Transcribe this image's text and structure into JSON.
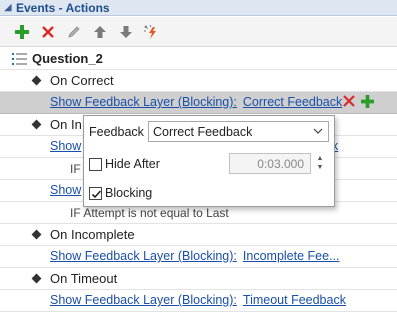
{
  "panel": {
    "title": "Events - Actions"
  },
  "toolbar": {
    "buttons": [
      {
        "name": "add",
        "icon": "plus-icon",
        "color": "#2a9d2a"
      },
      {
        "name": "delete",
        "icon": "x-icon",
        "color": "#d92b2b"
      },
      {
        "name": "edit",
        "icon": "pencil-icon",
        "color": "#9a9a9a"
      },
      {
        "name": "move-up",
        "icon": "arrow-up-icon",
        "color": "#7a7a7a"
      },
      {
        "name": "move-down",
        "icon": "arrow-down-icon",
        "color": "#7a7a7a"
      },
      {
        "name": "magic",
        "icon": "magic-wand-icon",
        "color": "#e8561c"
      }
    ]
  },
  "tree": {
    "question": "Question_2",
    "rows": [
      {
        "type": "event",
        "label": "On Correct"
      },
      {
        "type": "action",
        "action": "Show Feedback Layer (Blocking):",
        "target": "Correct Feedback",
        "selected": true
      },
      {
        "type": "event",
        "label": "On In"
      },
      {
        "type": "action",
        "action": "Show",
        "target": "k"
      },
      {
        "type": "condition",
        "label": "IF"
      },
      {
        "type": "action",
        "action": "Show"
      },
      {
        "type": "condition",
        "label": "IF Attempt is not equal to Last"
      },
      {
        "type": "event",
        "label": "On Incomplete"
      },
      {
        "type": "action",
        "action": "Show Feedback Layer (Blocking):",
        "target": "Incomplete Fee..."
      },
      {
        "type": "event",
        "label": "On Timeout"
      },
      {
        "type": "action",
        "action": "Show Feedback Layer (Blocking):",
        "target": "Timeout Feedback"
      }
    ]
  },
  "popup": {
    "feedback_label": "Feedback",
    "feedback_value": "Correct Feedback",
    "hide_after_label": "Hide After",
    "hide_after_checked": false,
    "hide_after_value": "0:03.000",
    "blocking_label": "Blocking",
    "blocking_checked": true
  },
  "colors": {
    "link": "#1a4fa8",
    "header_bg": "#dde6f1",
    "selected_row": "#cfcfcf"
  }
}
